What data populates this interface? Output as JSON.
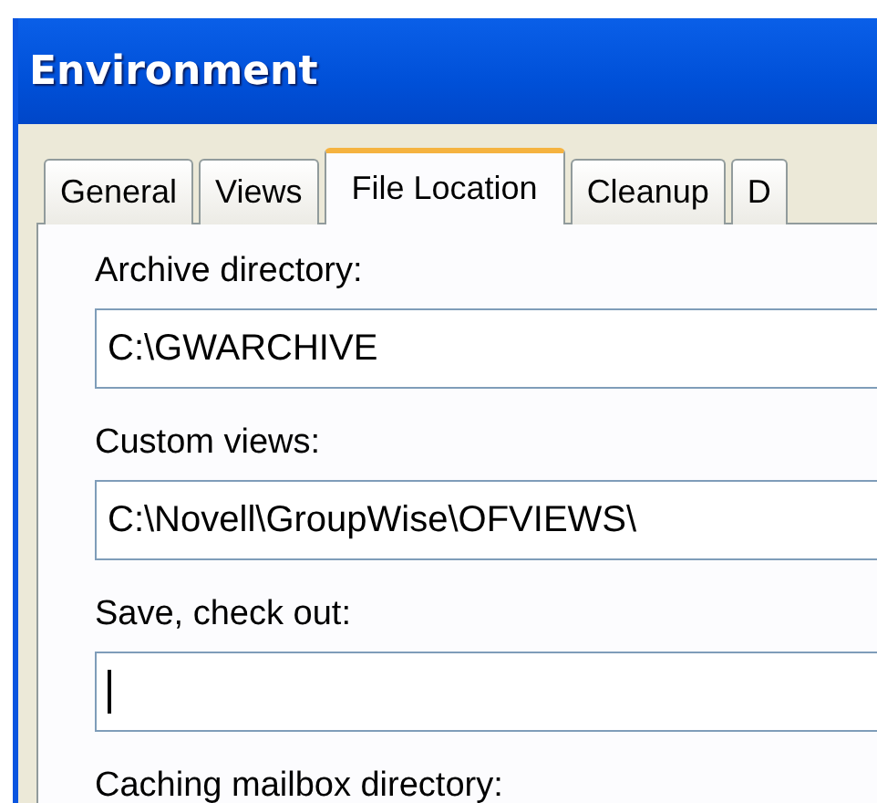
{
  "window": {
    "title": "Environment"
  },
  "tabs": [
    {
      "label": "General",
      "selected": false
    },
    {
      "label": "Views",
      "selected": false
    },
    {
      "label": "File Location",
      "selected": true
    },
    {
      "label": "Cleanup",
      "selected": false
    },
    {
      "label": "D",
      "selected": false
    }
  ],
  "fields": [
    {
      "label": "Archive directory:",
      "value": "C:\\GWARCHIVE",
      "focused": false
    },
    {
      "label": "Custom views:",
      "value": "C:\\Novell\\GroupWise\\OFVIEWS\\",
      "focused": false
    },
    {
      "label": "Save, check out:",
      "focused": true
    }
  ],
  "trailing_label": "Caching mailbox directory:"
}
